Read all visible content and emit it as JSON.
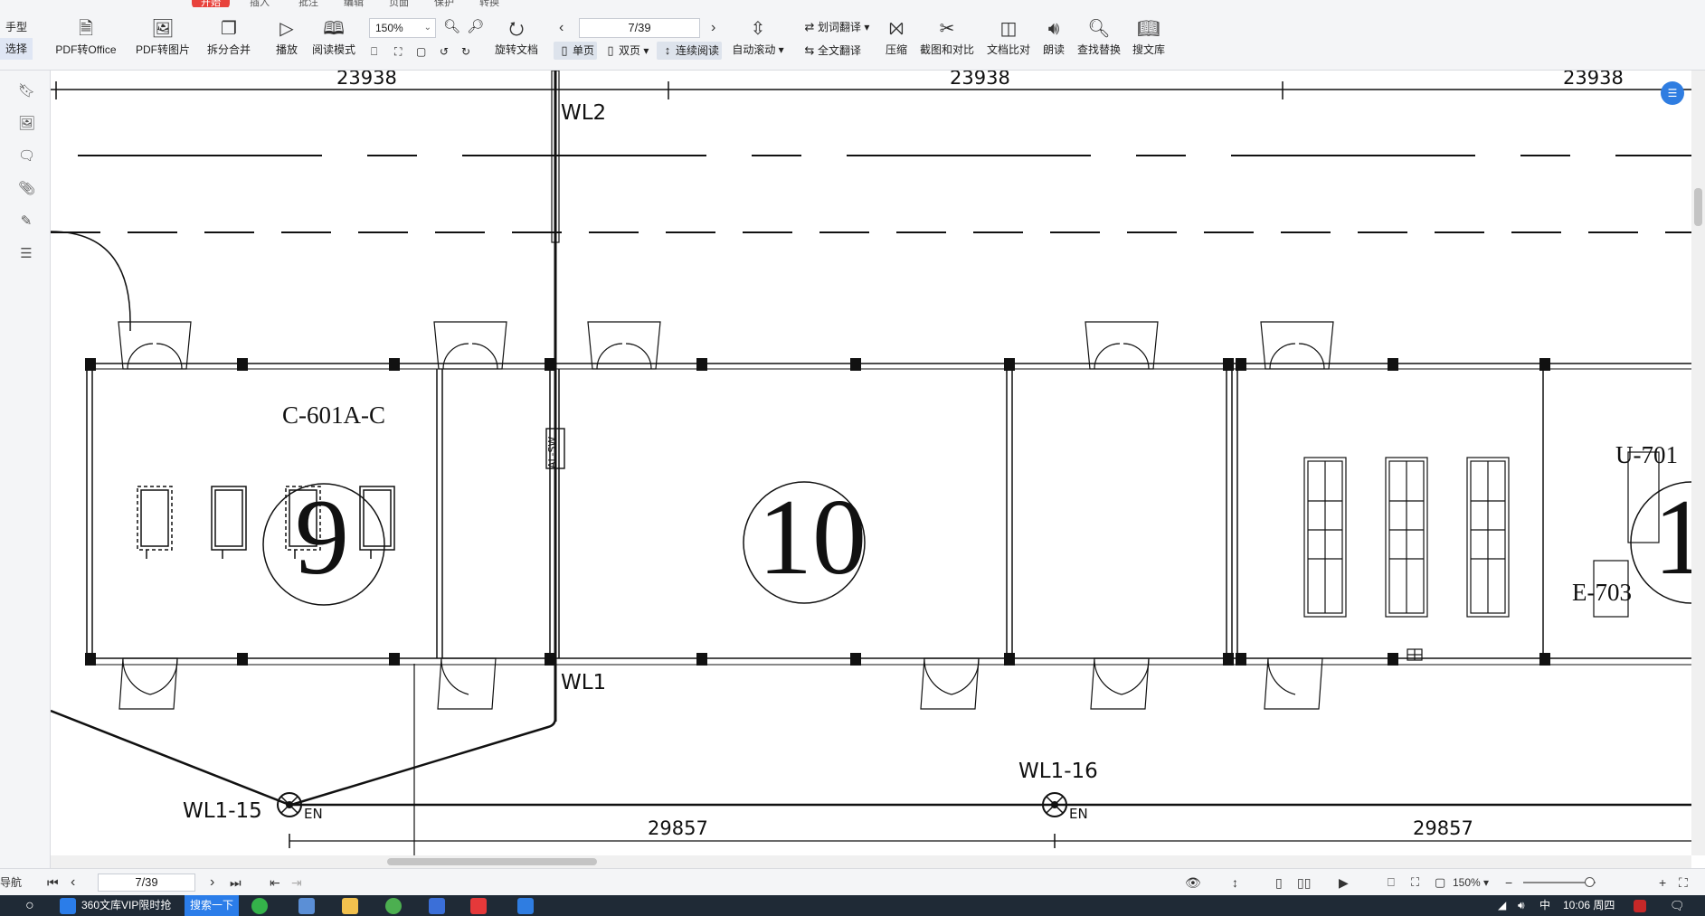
{
  "ribbon": {
    "tabs": [
      "开始",
      "插入",
      "批注",
      "编辑",
      "页面",
      "保护",
      "转换"
    ],
    "mode_hand": "手型",
    "mode_select": "选择",
    "pdf_to_office": "PDF转Office",
    "pdf_to_image": "PDF转图片",
    "split_merge": "拆分合并",
    "play": "播放",
    "read_mode": "阅读模式",
    "zoom_value": "150%",
    "page_value": "7/39",
    "rotate": "旋转文档",
    "single_page": "单页",
    "double_page": "双页",
    "continuous": "连续阅读",
    "auto_scroll": "自动滚动",
    "word_translate": "划词翻译",
    "full_translate": "全文翻译",
    "compress": "压缩",
    "screenshot_compare": "截图和对比",
    "doc_compare": "文档比对",
    "read_aloud": "朗读",
    "find_replace": "查找替换",
    "search_library": "搜文库"
  },
  "drawing": {
    "dim_top": [
      "23938",
      "23938",
      "23938"
    ],
    "dim_bottom": [
      "29857",
      "29857"
    ],
    "wl2": "WL2",
    "wl1": "WL1",
    "wl1_15": "WL1-15",
    "wl1_16": "WL1-16",
    "en_label": "EN",
    "room_9_label": "C-601A-C",
    "room_9_number": "9",
    "room_10_number": "10",
    "room_11_number": "1",
    "u701": "U-701",
    "e703": "E-703",
    "al_sw": "AL-SW"
  },
  "statusbar": {
    "nav_label": "导航",
    "page_value": "7/39",
    "zoom_value": "150%"
  },
  "taskbar": {
    "browser_tab": "360文库VIP限时抢",
    "search_tab": "搜索一下",
    "time": "10:06 周四",
    "ime": "中"
  }
}
